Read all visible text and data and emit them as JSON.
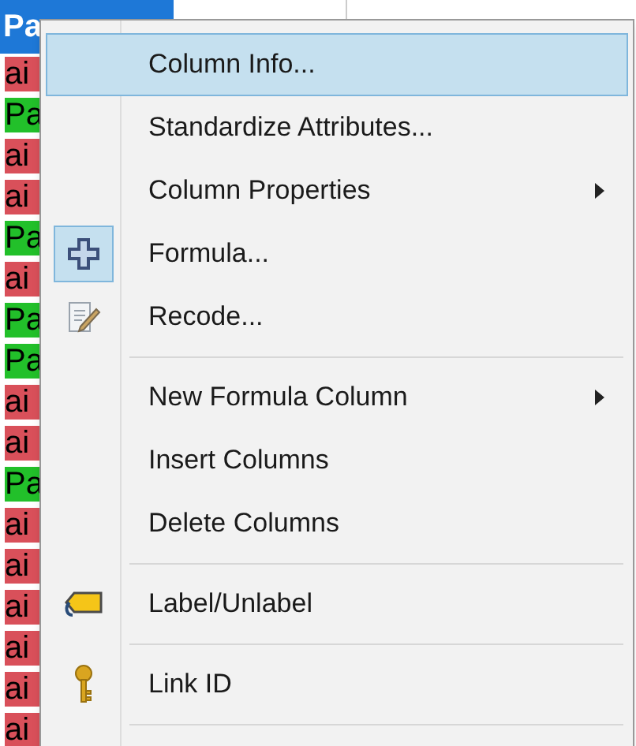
{
  "table": {
    "header": {
      "label": "Pa"
    },
    "rows": [
      {
        "text": "ai",
        "color": "#d9505a"
      },
      {
        "text": "Pa",
        "color": "#22c02a"
      },
      {
        "text": "ai",
        "color": "#d9505a"
      },
      {
        "text": "ai",
        "color": "#d9505a"
      },
      {
        "text": "Pa",
        "color": "#22c02a"
      },
      {
        "text": "ai",
        "color": "#d9505a"
      },
      {
        "text": "Pa",
        "color": "#22c02a"
      },
      {
        "text": "Pa",
        "color": "#22c02a"
      },
      {
        "text": "ai",
        "color": "#d9505a"
      },
      {
        "text": "ai",
        "color": "#d9505a"
      },
      {
        "text": "Pa",
        "color": "#22c02a"
      },
      {
        "text": "ai",
        "color": "#d9505a"
      },
      {
        "text": "ai",
        "color": "#d9505a"
      },
      {
        "text": "ai",
        "color": "#d9505a"
      },
      {
        "text": "ai",
        "color": "#d9505a"
      },
      {
        "text": "ai",
        "color": "#d9505a"
      },
      {
        "text": "ai",
        "color": "#d9505a"
      }
    ]
  },
  "context_menu": {
    "items": [
      {
        "kind": "text",
        "label": "Column Info...",
        "selected": true,
        "submenu": false
      },
      {
        "kind": "text",
        "label": "Standardize Attributes...",
        "selected": false,
        "submenu": false
      },
      {
        "kind": "text",
        "label": "Column Properties",
        "selected": false,
        "submenu": true
      },
      {
        "kind": "plus",
        "label": "Formula...",
        "selected": false,
        "submenu": false,
        "checked": true
      },
      {
        "kind": "pencil",
        "label": "Recode...",
        "selected": false,
        "submenu": false,
        "checked": false
      },
      {
        "kind": "separator"
      },
      {
        "kind": "text",
        "label": "New Formula Column",
        "selected": false,
        "submenu": true
      },
      {
        "kind": "text",
        "label": "Insert Columns",
        "selected": false,
        "submenu": false
      },
      {
        "kind": "text",
        "label": "Delete Columns",
        "selected": false,
        "submenu": false
      },
      {
        "kind": "separator"
      },
      {
        "kind": "tag",
        "label": "Label/Unlabel",
        "selected": false,
        "submenu": false,
        "checked": false
      },
      {
        "kind": "separator"
      },
      {
        "kind": "key",
        "label": "Link ID",
        "selected": false,
        "submenu": false,
        "checked": false
      },
      {
        "kind": "separator"
      }
    ]
  }
}
